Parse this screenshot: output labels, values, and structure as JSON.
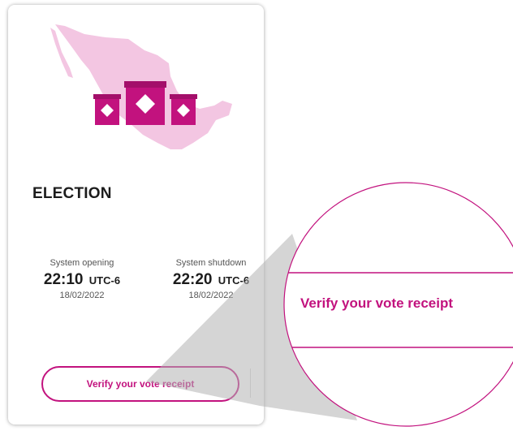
{
  "card": {
    "title": "ELECTION",
    "opening": {
      "label": "System opening",
      "time": "22:10",
      "timezone": "UTC-6",
      "date": "18/02/2022"
    },
    "shutdown": {
      "label": "System shutdown",
      "time": "22:20",
      "timezone": "UTC-6",
      "date": "18/02/2022"
    },
    "verify_button": "Verify your vote receipt"
  },
  "magnifier": {
    "label": "Verify your vote receipt"
  },
  "illustration": {
    "icon": "mexico-map-ballot-boxes",
    "map_color": "#f3c6e2",
    "box_color": "#c2127e"
  },
  "colors": {
    "accent": "#c2127e",
    "text": "#1c1c1c",
    "muted": "#555555"
  }
}
